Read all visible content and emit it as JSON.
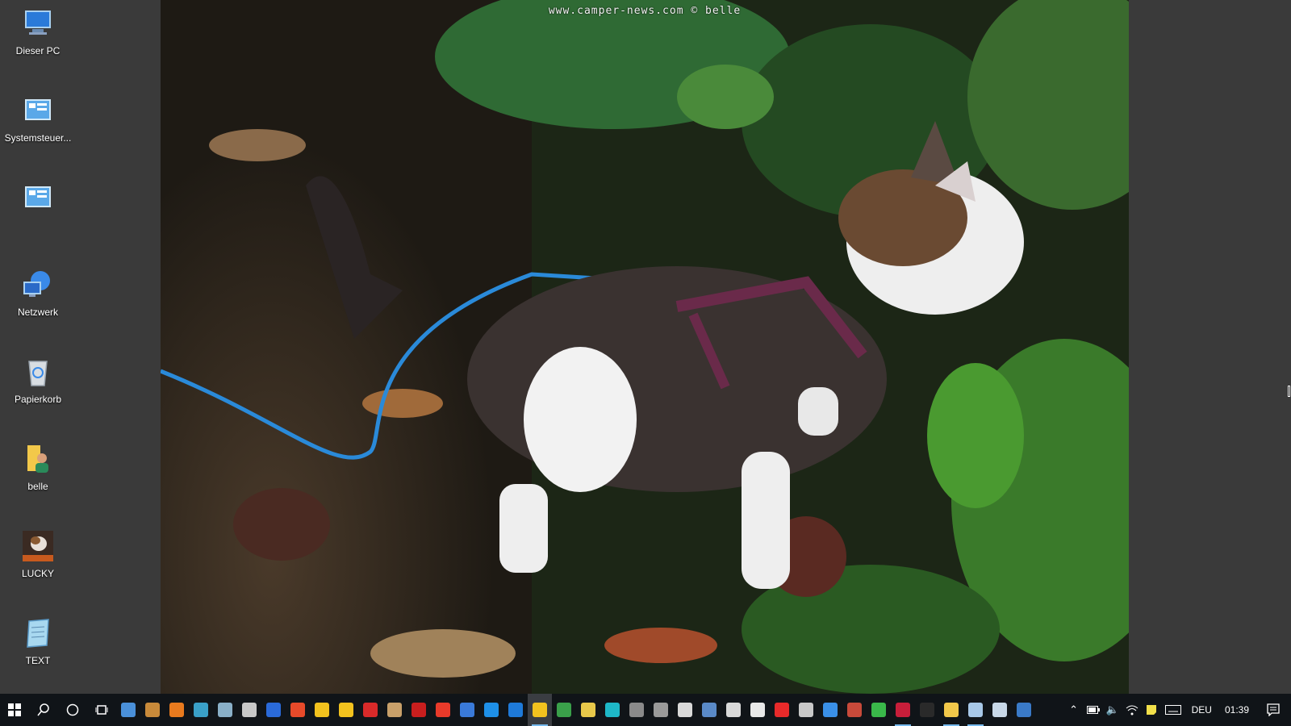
{
  "desktop": {
    "wallpaper": {
      "watermark": "www.camper-news.com © belle"
    },
    "icons": [
      {
        "label": "Dieser PC",
        "icon": "computer-icon"
      },
      {
        "label": "Systemsteuer...",
        "icon": "control-panel-icon"
      },
      {
        "label": "",
        "icon": "control-panel-icon"
      },
      {
        "label": "Netzwerk",
        "icon": "network-icon"
      },
      {
        "label": "Papierkorb",
        "icon": "recycle-bin-icon"
      },
      {
        "label": "belle",
        "icon": "user-folder-icon"
      },
      {
        "label": "LUCKY",
        "icon": "photo-icon"
      },
      {
        "label": "TEXT",
        "icon": "notepad-icon"
      }
    ]
  },
  "taskbar": {
    "start_icon": "windows-logo-icon",
    "search_icon": "search-icon",
    "cortana_icon": "cortana-circle-icon",
    "taskview_icon": "task-view-icon",
    "pinned_apps": [
      {
        "icon": "app-icon",
        "color": "#4a90d9"
      },
      {
        "icon": "app-icon",
        "color": "#c88a3a"
      },
      {
        "icon": "search-app-icon",
        "color": "#e87a1e"
      },
      {
        "icon": "app-icon",
        "color": "#3aa0c8"
      },
      {
        "icon": "app-icon",
        "color": "#8ab0c8"
      },
      {
        "icon": "app-icon",
        "color": "#c8c8c8"
      },
      {
        "icon": "app-icon",
        "color": "#2a6ad9"
      },
      {
        "icon": "app-icon",
        "color": "#e84a2a"
      },
      {
        "icon": "app-icon",
        "color": "#f2c21e"
      },
      {
        "icon": "app-icon",
        "color": "#f2c21e"
      },
      {
        "icon": "acrobat-icon",
        "color": "#d92a2a"
      },
      {
        "icon": "app-icon",
        "color": "#c8a06a"
      },
      {
        "icon": "filezilla-icon",
        "color": "#c81e1e"
      },
      {
        "icon": "download-icon",
        "color": "#e83a2a"
      },
      {
        "icon": "app-icon",
        "color": "#3a7ad9"
      },
      {
        "icon": "ie-icon",
        "color": "#1e90e8"
      },
      {
        "icon": "edge-icon",
        "color": "#1e7ad9"
      },
      {
        "icon": "chrome-icon",
        "color": "#f2c21e"
      },
      {
        "icon": "chrome-icon",
        "color": "#3aa04a"
      },
      {
        "icon": "app-icon",
        "color": "#e8c84a"
      },
      {
        "icon": "app-icon",
        "color": "#1eb8c8"
      },
      {
        "icon": "calculator-icon",
        "color": "#8a8a8a"
      },
      {
        "icon": "camera-icon",
        "color": "#9a9a9a"
      },
      {
        "icon": "app-icon",
        "color": "#d9d9d9"
      },
      {
        "icon": "app-icon",
        "color": "#5a8ac8"
      },
      {
        "icon": "pen-icon",
        "color": "#d9d9d9"
      },
      {
        "icon": "app-icon",
        "color": "#e8e8e8"
      },
      {
        "icon": "app-icon",
        "color": "#e82a2a"
      },
      {
        "icon": "app-icon",
        "color": "#c8c8c8"
      },
      {
        "icon": "app-icon",
        "color": "#3a90e8"
      },
      {
        "icon": "app-icon",
        "color": "#c84a3a"
      },
      {
        "icon": "app-icon",
        "color": "#3ab84a"
      },
      {
        "icon": "app-icon",
        "color": "#c81e3a"
      },
      {
        "icon": "app-icon",
        "color": "#2a2a2a"
      },
      {
        "icon": "file-explorer-icon",
        "color": "#f2c84a"
      },
      {
        "icon": "app-icon",
        "color": "#a8c8e8"
      },
      {
        "icon": "app-icon",
        "color": "#c8d8e8"
      },
      {
        "icon": "app-icon",
        "color": "#3a7ac8"
      }
    ],
    "tray": {
      "chevron_icon": "chevron-up-icon",
      "battery_icon": "battery-icon",
      "volume_icon": "volume-icon",
      "wifi_icon": "wifi-icon",
      "note_icon": "sticky-note-icon",
      "keyboard_icon": "keyboard-icon",
      "language": "DEU",
      "time": "01:39",
      "notification_icon": "action-center-icon"
    }
  }
}
